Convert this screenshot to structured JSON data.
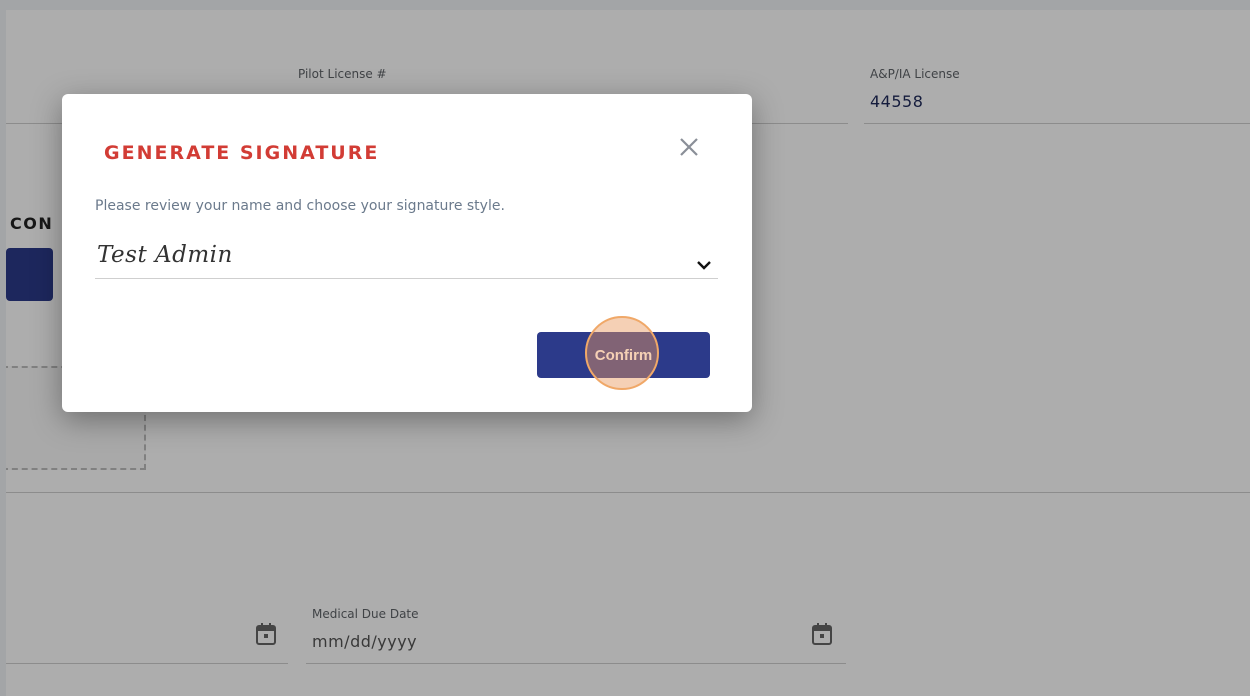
{
  "background": {
    "pilot_license_label": "Pilot License #",
    "ap_ia_license_label": "A&P/IA License",
    "ap_ia_license_value": "44558",
    "section_title_fragment": "CON",
    "medical_due_date_label": "Medical Due Date",
    "medical_due_date_placeholder": "mm/dd/yyyy"
  },
  "modal": {
    "title": "GENERATE SIGNATURE",
    "description": "Please review your name and choose your signature style.",
    "signature_value": "Test Admin",
    "confirm_label": "Confirm"
  },
  "colors": {
    "title_red": "#d23c35",
    "primary_navy": "#2c3a8a",
    "highlight_orange": "#f0a868"
  },
  "icons": {
    "close": "close-icon",
    "dropdown": "chevron-down-icon",
    "calendar": "calendar-icon"
  }
}
